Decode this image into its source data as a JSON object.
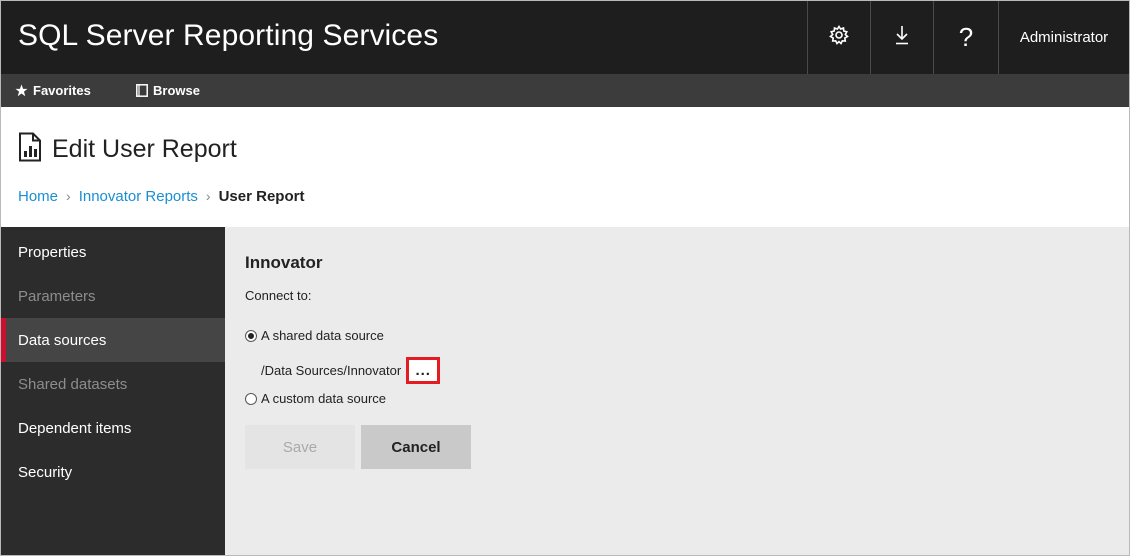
{
  "app": {
    "title": "SQL Server Reporting Services",
    "user": "Administrator",
    "help_glyph": "?"
  },
  "subnav": {
    "favorites": "Favorites",
    "browse": "Browse"
  },
  "header": {
    "page_title": "Edit User Report",
    "breadcrumb": {
      "home": "Home",
      "parent": "Innovator Reports",
      "current": "User Report"
    }
  },
  "sidebar": {
    "items": [
      {
        "label": "Properties",
        "state": "enabled"
      },
      {
        "label": "Parameters",
        "state": "disabled"
      },
      {
        "label": "Data sources",
        "state": "active"
      },
      {
        "label": "Shared datasets",
        "state": "disabled"
      },
      {
        "label": "Dependent items",
        "state": "enabled"
      },
      {
        "label": "Security",
        "state": "enabled"
      }
    ]
  },
  "main": {
    "section_title": "Innovator",
    "connect_label": "Connect to:",
    "option_shared": "A shared data source",
    "shared_path": "/Data Sources/Innovator",
    "browse_button": "...",
    "option_custom": "A custom data source",
    "save_label": "Save",
    "cancel_label": "Cancel"
  },
  "colors": {
    "topbar": "#1e1e1e",
    "subnav": "#3c3c3c",
    "sidebar": "#2c2c2c",
    "active_marker": "#c8102e",
    "link": "#1a8fd3",
    "highlight": "#e31b23"
  }
}
